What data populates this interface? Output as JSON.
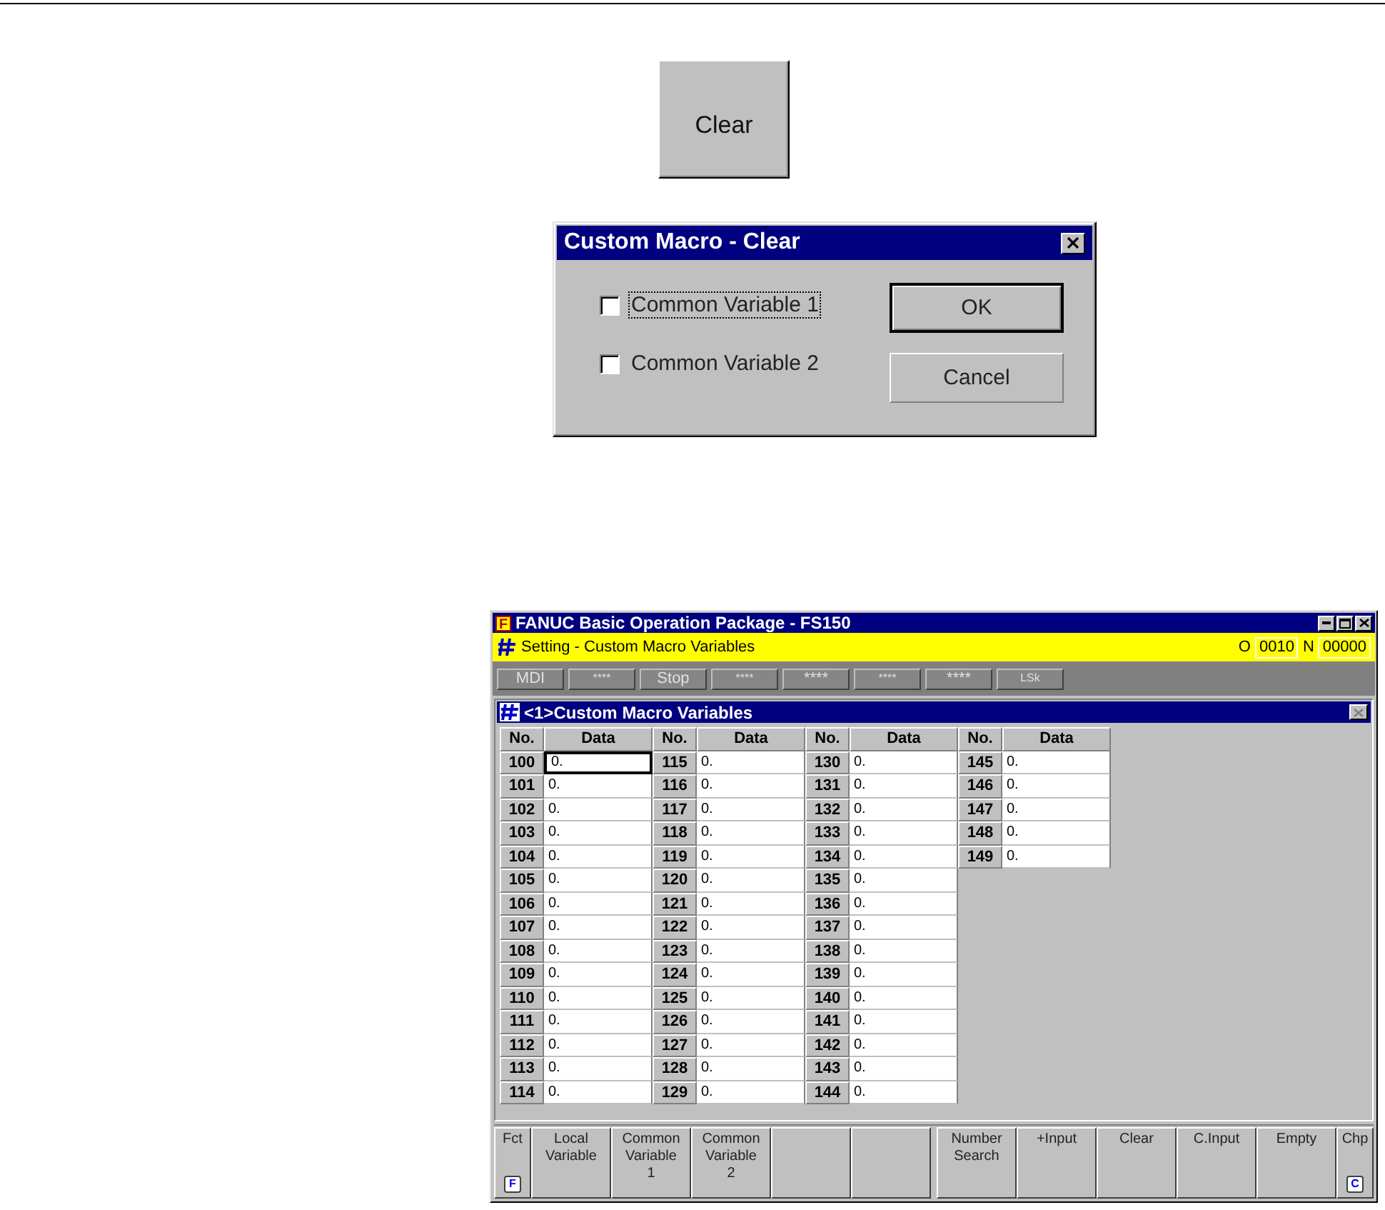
{
  "clear_button": {
    "label": "Clear"
  },
  "dialog": {
    "title": "Custom Macro - Clear",
    "checkboxes": [
      {
        "label": "Common Variable 1",
        "checked": false,
        "focused": true
      },
      {
        "label": "Common Variable 2",
        "checked": false,
        "focused": false
      }
    ],
    "buttons": [
      {
        "label": "OK",
        "default": true
      },
      {
        "label": "Cancel",
        "default": false
      }
    ]
  },
  "window": {
    "app_letter": "F",
    "title": "FANUC Basic Operation Package - FS150",
    "status_bar": {
      "title": "Setting - Custom Macro Variables",
      "o_label": "O",
      "o_value": "0010",
      "n_label": "N",
      "n_value": "00000"
    },
    "mode_buttons": [
      "MDI",
      "****",
      "Stop",
      "****",
      "****",
      "****",
      "****",
      "LSk"
    ],
    "panel": {
      "title": "<1>Custom Macro Variables",
      "groups": [
        {
          "columns": [
            "No.",
            "Data"
          ],
          "rows": [
            {
              "no": "100",
              "data": "0.",
              "selected": true
            },
            {
              "no": "101",
              "data": "0.",
              "selected": false
            },
            {
              "no": "102",
              "data": "0.",
              "selected": false
            },
            {
              "no": "103",
              "data": "0.",
              "selected": false
            },
            {
              "no": "104",
              "data": "0.",
              "selected": false
            },
            {
              "no": "105",
              "data": "0.",
              "selected": false
            },
            {
              "no": "106",
              "data": "0.",
              "selected": false
            },
            {
              "no": "107",
              "data": "0.",
              "selected": false
            },
            {
              "no": "108",
              "data": "0.",
              "selected": false
            },
            {
              "no": "109",
              "data": "0.",
              "selected": false
            },
            {
              "no": "110",
              "data": "0.",
              "selected": false
            },
            {
              "no": "111",
              "data": "0.",
              "selected": false
            },
            {
              "no": "112",
              "data": "0.",
              "selected": false
            },
            {
              "no": "113",
              "data": "0.",
              "selected": false
            },
            {
              "no": "114",
              "data": "0.",
              "selected": false
            }
          ]
        },
        {
          "columns": [
            "No.",
            "Data"
          ],
          "rows": [
            {
              "no": "115",
              "data": "0.",
              "selected": false
            },
            {
              "no": "116",
              "data": "0.",
              "selected": false
            },
            {
              "no": "117",
              "data": "0.",
              "selected": false
            },
            {
              "no": "118",
              "data": "0.",
              "selected": false
            },
            {
              "no": "119",
              "data": "0.",
              "selected": false
            },
            {
              "no": "120",
              "data": "0.",
              "selected": false
            },
            {
              "no": "121",
              "data": "0.",
              "selected": false
            },
            {
              "no": "122",
              "data": "0.",
              "selected": false
            },
            {
              "no": "123",
              "data": "0.",
              "selected": false
            },
            {
              "no": "124",
              "data": "0.",
              "selected": false
            },
            {
              "no": "125",
              "data": "0.",
              "selected": false
            },
            {
              "no": "126",
              "data": "0.",
              "selected": false
            },
            {
              "no": "127",
              "data": "0.",
              "selected": false
            },
            {
              "no": "128",
              "data": "0.",
              "selected": false
            },
            {
              "no": "129",
              "data": "0.",
              "selected": false
            }
          ]
        },
        {
          "columns": [
            "No.",
            "Data"
          ],
          "rows": [
            {
              "no": "130",
              "data": "0.",
              "selected": false
            },
            {
              "no": "131",
              "data": "0.",
              "selected": false
            },
            {
              "no": "132",
              "data": "0.",
              "selected": false
            },
            {
              "no": "133",
              "data": "0.",
              "selected": false
            },
            {
              "no": "134",
              "data": "0.",
              "selected": false
            },
            {
              "no": "135",
              "data": "0.",
              "selected": false
            },
            {
              "no": "136",
              "data": "0.",
              "selected": false
            },
            {
              "no": "137",
              "data": "0.",
              "selected": false
            },
            {
              "no": "138",
              "data": "0.",
              "selected": false
            },
            {
              "no": "139",
              "data": "0.",
              "selected": false
            },
            {
              "no": "140",
              "data": "0.",
              "selected": false
            },
            {
              "no": "141",
              "data": "0.",
              "selected": false
            },
            {
              "no": "142",
              "data": "0.",
              "selected": false
            },
            {
              "no": "143",
              "data": "0.",
              "selected": false
            },
            {
              "no": "144",
              "data": "0.",
              "selected": false
            }
          ]
        },
        {
          "columns": [
            "No.",
            "Data"
          ],
          "rows": [
            {
              "no": "145",
              "data": "0.",
              "selected": false
            },
            {
              "no": "146",
              "data": "0.",
              "selected": false
            },
            {
              "no": "147",
              "data": "0.",
              "selected": false
            },
            {
              "no": "148",
              "data": "0.",
              "selected": false
            },
            {
              "no": "149",
              "data": "0.",
              "selected": false
            }
          ]
        }
      ]
    },
    "soft_keys": [
      {
        "kind": "lettered",
        "label": "Fct",
        "letter": "F"
      },
      {
        "kind": "plain",
        "label": "Local\nVariable"
      },
      {
        "kind": "plain",
        "label": "Common\nVariable\n1"
      },
      {
        "kind": "plain",
        "label": "Common\nVariable\n2"
      },
      {
        "kind": "blank"
      },
      {
        "kind": "blank"
      },
      {
        "kind": "gap"
      },
      {
        "kind": "plain",
        "label": "Number\nSearch"
      },
      {
        "kind": "plain",
        "label": "+Input"
      },
      {
        "kind": "plain",
        "label": "Clear"
      },
      {
        "kind": "plain",
        "label": "C.Input"
      },
      {
        "kind": "plain",
        "label": "Empty"
      },
      {
        "kind": "lettered",
        "label": "Chp",
        "letter": "C"
      }
    ]
  }
}
